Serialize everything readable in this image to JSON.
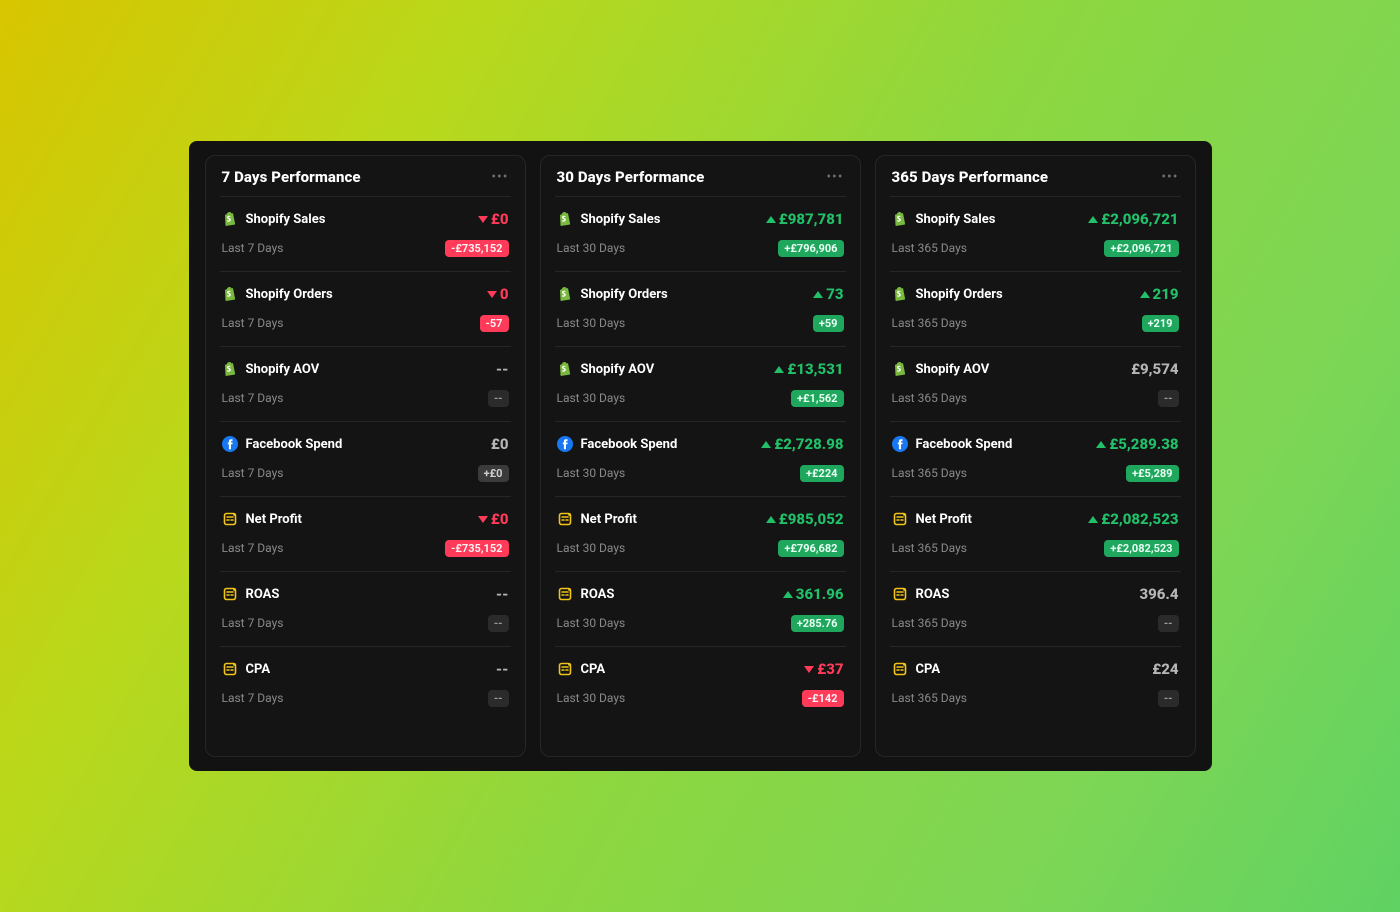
{
  "columns": [
    {
      "id": "col-7",
      "title": "7 Days Performance",
      "sublabel": "Last 7 Days",
      "metrics": [
        {
          "icon": "shopify",
          "name": "shopify-sales",
          "label": "Shopify Sales",
          "value": "£0",
          "trend": "down",
          "badge": "-£735,152",
          "badgeTone": "red"
        },
        {
          "icon": "shopify",
          "name": "shopify-orders",
          "label": "Shopify Orders",
          "value": "0",
          "trend": "down",
          "badge": "-57",
          "badgeTone": "red"
        },
        {
          "icon": "shopify",
          "name": "shopify-aov",
          "label": "Shopify AOV",
          "value": "--",
          "trend": "flat",
          "badge": "--",
          "badgeTone": "dark"
        },
        {
          "icon": "facebook",
          "name": "facebook-spend",
          "label": "Facebook Spend",
          "value": "£0",
          "trend": "flat",
          "badge": "+£0",
          "badgeTone": "grey"
        },
        {
          "icon": "calc",
          "name": "net-profit",
          "label": "Net Profit",
          "value": "£0",
          "trend": "down",
          "badge": "-£735,152",
          "badgeTone": "red"
        },
        {
          "icon": "calc",
          "name": "roas",
          "label": "ROAS",
          "value": "--",
          "trend": "flat",
          "badge": "--",
          "badgeTone": "dark"
        },
        {
          "icon": "calc",
          "name": "cpa",
          "label": "CPA",
          "value": "--",
          "trend": "flat",
          "badge": "--",
          "badgeTone": "dark"
        }
      ]
    },
    {
      "id": "col-30",
      "title": "30 Days Performance",
      "sublabel": "Last 30 Days",
      "metrics": [
        {
          "icon": "shopify",
          "name": "shopify-sales",
          "label": "Shopify Sales",
          "value": "£987,781",
          "trend": "up",
          "badge": "+£796,906",
          "badgeTone": "green"
        },
        {
          "icon": "shopify",
          "name": "shopify-orders",
          "label": "Shopify Orders",
          "value": "73",
          "trend": "up",
          "badge": "+59",
          "badgeTone": "green"
        },
        {
          "icon": "shopify",
          "name": "shopify-aov",
          "label": "Shopify AOV",
          "value": "£13,531",
          "trend": "up",
          "badge": "+£1,562",
          "badgeTone": "green"
        },
        {
          "icon": "facebook",
          "name": "facebook-spend",
          "label": "Facebook Spend",
          "value": "£2,728.98",
          "trend": "up",
          "badge": "+£224",
          "badgeTone": "green"
        },
        {
          "icon": "calc",
          "name": "net-profit",
          "label": "Net Profit",
          "value": "£985,052",
          "trend": "up",
          "badge": "+£796,682",
          "badgeTone": "green"
        },
        {
          "icon": "calc",
          "name": "roas",
          "label": "ROAS",
          "value": "361.96",
          "trend": "up",
          "badge": "+285.76",
          "badgeTone": "green"
        },
        {
          "icon": "calc",
          "name": "cpa",
          "label": "CPA",
          "value": "£37",
          "trend": "down",
          "badge": "-£142",
          "badgeTone": "red"
        }
      ]
    },
    {
      "id": "col-365",
      "title": "365 Days Performance",
      "sublabel": "Last 365 Days",
      "metrics": [
        {
          "icon": "shopify",
          "name": "shopify-sales",
          "label": "Shopify Sales",
          "value": "£2,096,721",
          "trend": "up",
          "badge": "+£2,096,721",
          "badgeTone": "green"
        },
        {
          "icon": "shopify",
          "name": "shopify-orders",
          "label": "Shopify Orders",
          "value": "219",
          "trend": "up",
          "badge": "+219",
          "badgeTone": "green"
        },
        {
          "icon": "shopify",
          "name": "shopify-aov",
          "label": "Shopify AOV",
          "value": "£9,574",
          "trend": "flat",
          "badge": "--",
          "badgeTone": "dark"
        },
        {
          "icon": "facebook",
          "name": "facebook-spend",
          "label": "Facebook Spend",
          "value": "£5,289.38",
          "trend": "up",
          "badge": "+£5,289",
          "badgeTone": "green"
        },
        {
          "icon": "calc",
          "name": "net-profit",
          "label": "Net Profit",
          "value": "£2,082,523",
          "trend": "up",
          "badge": "+£2,082,523",
          "badgeTone": "green"
        },
        {
          "icon": "calc",
          "name": "roas",
          "label": "ROAS",
          "value": "396.4",
          "trend": "flat",
          "badge": "--",
          "badgeTone": "dark"
        },
        {
          "icon": "calc",
          "name": "cpa",
          "label": "CPA",
          "value": "£24",
          "trend": "flat",
          "badge": "--",
          "badgeTone": "dark"
        }
      ]
    }
  ]
}
